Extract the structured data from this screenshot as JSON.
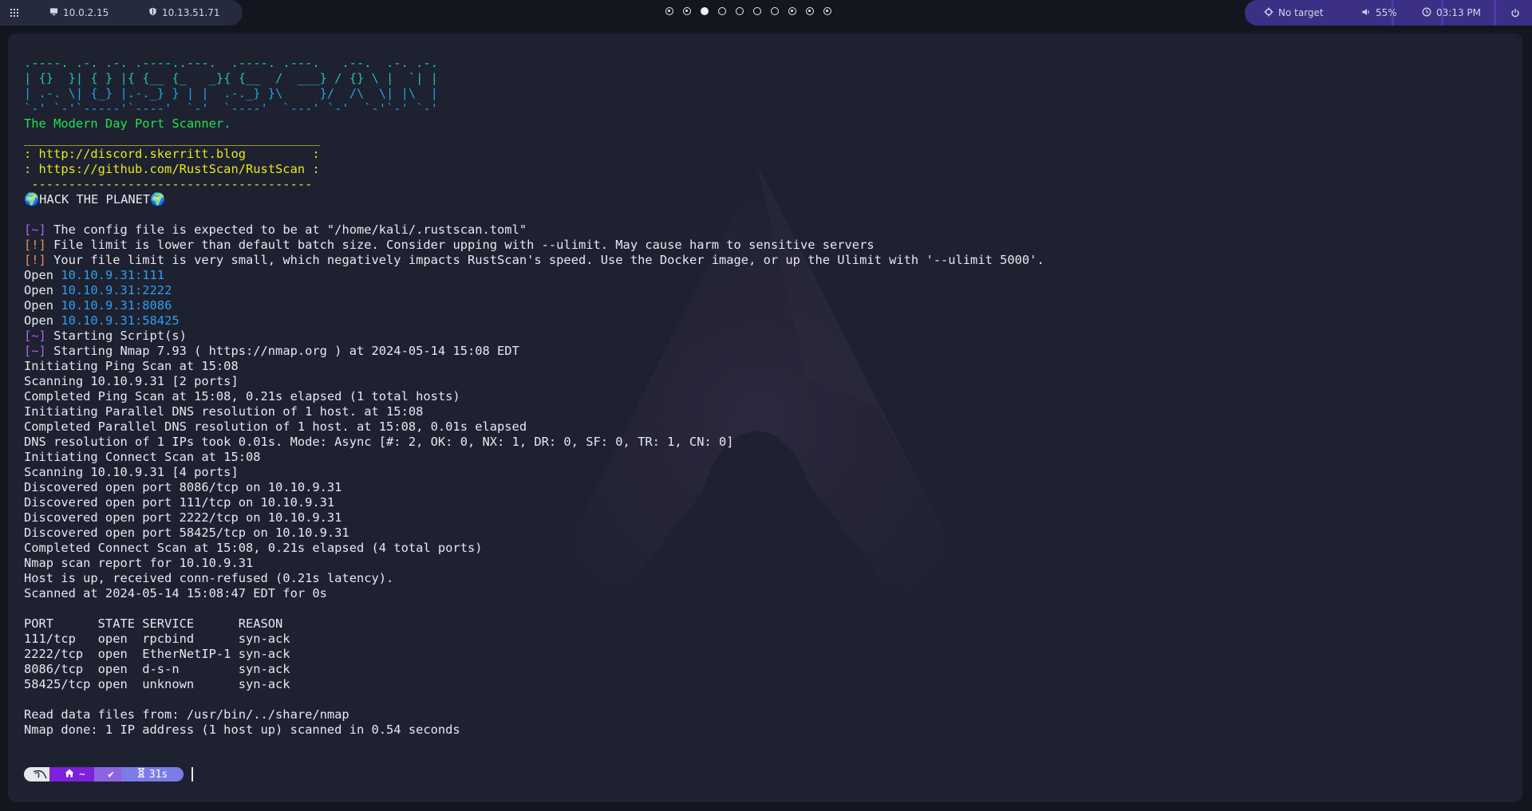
{
  "topbar": {
    "menu_icon": "grid-icon",
    "ips": [
      {
        "icon": "monitor-icon",
        "label": "10.0.2.15"
      },
      {
        "icon": "shield-icon",
        "label": "10.13.51.71"
      }
    ],
    "workspaces": [
      {
        "state": "occupied"
      },
      {
        "state": "occupied"
      },
      {
        "state": "active"
      },
      {
        "state": "empty"
      },
      {
        "state": "empty"
      },
      {
        "state": "empty"
      },
      {
        "state": "empty"
      },
      {
        "state": "occupied"
      },
      {
        "state": "occupied"
      },
      {
        "state": "occupied"
      }
    ],
    "target_label": "No target",
    "volume_label": "55%",
    "clock_label": "03:13 PM",
    "power_icon": "power-icon"
  },
  "terminal": {
    "banner": [
      ".----. .-. .-. .----..---.  .----. .---.   .--.  .-. .-.",
      "| {}  }| { } |{ {__ {_   _}{ {__  /  ___} / {} \\ |  `| |",
      "| .-. \\| {_} |.-._} } | |  .-._} }\\     }/  /\\  \\| |\\  |",
      "`-' `-'`-----'`----'  `-'  `----'  `---' `-'  `-'`-' `-'"
    ],
    "tagline": "The Modern Day Port Scanner.",
    "box_top": "________________________________________",
    "box_line1": ": http://discord.skerritt.blog         :",
    "box_line2": ": https://github.com/RustScan/RustScan :",
    "box_bottom": " --------------------------------------",
    "hack": "🌍HACK THE PLANET🌍",
    "tag_info": "[~]",
    "tag_warn": "[!]",
    "config_msg": " The config file is expected to be at \"/home/kali/.rustscan.toml\"",
    "warn1": " File limit is lower than default batch size. Consider upping with --ulimit. May cause harm to sensitive servers",
    "warn2": " Your file limit is very small, which negatively impacts RustScan's speed. Use the Docker image, or up the Ulimit with '--ulimit 5000'.",
    "open_word": "Open ",
    "open_ports": [
      "10.10.9.31:111",
      "10.10.9.31:2222",
      "10.10.9.31:8086",
      "10.10.9.31:58425"
    ],
    "starting_scripts": " Starting Script(s)",
    "starting_nmap": " Starting Nmap 7.93 ( https://nmap.org ) at 2024-05-14 15:08 EDT",
    "nmap_lines": [
      "Initiating Ping Scan at 15:08",
      "Scanning 10.10.9.31 [2 ports]",
      "Completed Ping Scan at 15:08, 0.21s elapsed (1 total hosts)",
      "Initiating Parallel DNS resolution of 1 host. at 15:08",
      "Completed Parallel DNS resolution of 1 host. at 15:08, 0.01s elapsed",
      "DNS resolution of 1 IPs took 0.01s. Mode: Async [#: 2, OK: 0, NX: 1, DR: 0, SF: 0, TR: 1, CN: 0]",
      "Initiating Connect Scan at 15:08",
      "Scanning 10.10.9.31 [4 ports]",
      "Discovered open port 8086/tcp on 10.10.9.31",
      "Discovered open port 111/tcp on 10.10.9.31",
      "Discovered open port 2222/tcp on 10.10.9.31",
      "Discovered open port 58425/tcp on 10.10.9.31",
      "Completed Connect Scan at 15:08, 0.21s elapsed (4 total ports)",
      "Nmap scan report for 10.10.9.31",
      "Host is up, received conn-refused (0.21s latency).",
      "Scanned at 2024-05-14 15:08:47 EDT for 0s"
    ],
    "port_table": {
      "header": "PORT      STATE SERVICE      REASON",
      "rows": [
        "111/tcp   open  rpcbind      syn-ack",
        "2222/tcp  open  EtherNetIP-1 syn-ack",
        "8086/tcp  open  d-s-n        syn-ack",
        "58425/tcp open  unknown      syn-ack"
      ]
    },
    "footer_lines": [
      "Read data files from: /usr/bin/../share/nmap",
      "Nmap done: 1 IP address (1 host up) scanned in 0.54 seconds"
    ]
  },
  "prompt": {
    "os_icon": "kali-dragon-icon",
    "home_icon": "home-icon",
    "dir": "~",
    "status": "✔",
    "timer_icon": "hourglass-icon",
    "duration": "31s"
  }
}
